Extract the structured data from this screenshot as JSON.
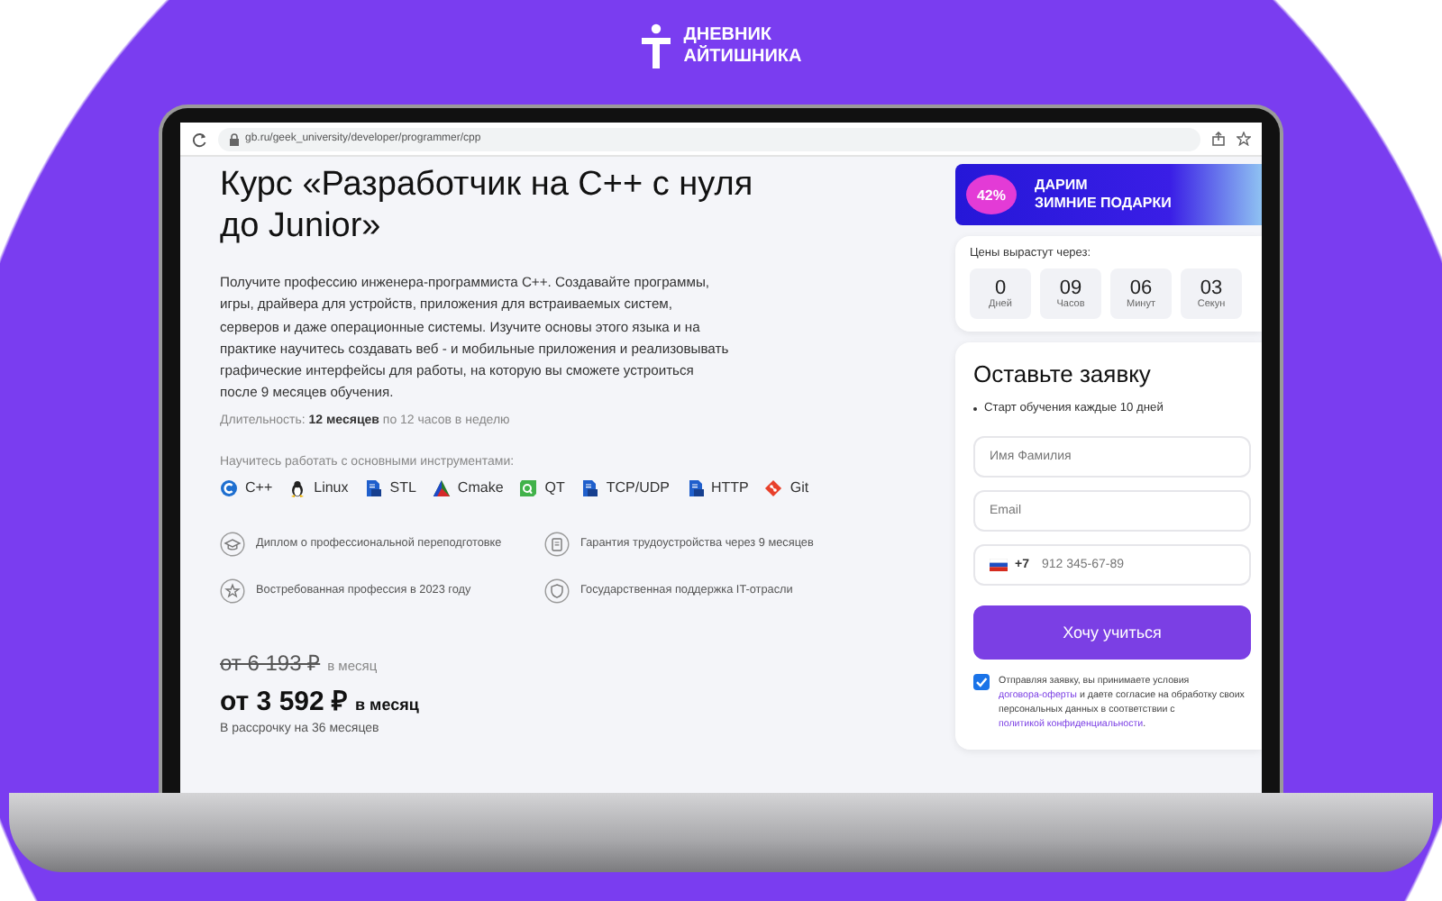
{
  "brand": {
    "line1": "ДНЕВНИК",
    "line2": "АЙТИШНИКА"
  },
  "browser": {
    "url": "gb.ru/geek_university/developer/programmer/cpp"
  },
  "course": {
    "title": "Курс «Разработчик на С++ с нуля до Junior»",
    "description": "Получите профессию инженера-программиста С++. Создавайте программы, игры, драйвера для устройств, приложения для встраиваемых систем, серверов и даже операционные системы. Изучите основы этого языка и на практике научитесь создавать веб - и мобильные приложения и реализовывать графические интерфейсы для работы, на которую вы сможете устроиться после 9 месяцев обучения.",
    "duration": "Длительность: **12 месяцев** по 12 часов в неделю",
    "tools_heading": "Научитесь работать с основными инструментами:",
    "tools": [
      {
        "kind": "cpp",
        "label": "C++"
      },
      {
        "kind": "linux",
        "label": "Linux"
      },
      {
        "kind": "doc",
        "label": "STL"
      },
      {
        "kind": "triangle",
        "label": "Cmake"
      },
      {
        "kind": "qt",
        "label": "QT"
      },
      {
        "kind": "doc",
        "label": "TCP/UDP"
      },
      {
        "kind": "doc",
        "label": "HTTP"
      },
      {
        "kind": "git",
        "label": "Git"
      }
    ],
    "features": [
      {
        "kind": "diploma",
        "text": "Диплом о профессиональной переподготовке"
      },
      {
        "kind": "document",
        "text": "Гарантия трудоустройства через 9 месяцев"
      },
      {
        "kind": "star",
        "text": "Востребованная профессия в 2023 году"
      },
      {
        "kind": "shield",
        "text": "Государственная поддержка IT-отрасли"
      }
    ],
    "old_price": "от 6 193 ₽",
    "old_price_suffix": "в месяц",
    "price": "от 3 592 ₽",
    "price_suffix": "в месяц",
    "installment": "В рассрочку на 36 месяцев"
  },
  "promo": {
    "badge": "42%",
    "line1": "ДАРИМ",
    "line2": "ЗИМНИЕ ПОДАРКИ"
  },
  "timer": {
    "heading": "Цены вырастут через:",
    "cells": [
      {
        "value": "0",
        "unit": "Дней"
      },
      {
        "value": "09",
        "unit": "Часов"
      },
      {
        "value": "06",
        "unit": "Минут"
      },
      {
        "value": "03",
        "unit": "Секун"
      }
    ]
  },
  "form": {
    "title": "Оставьте заявку",
    "bullet": "Старт обучения каждые 10 дней",
    "fields": [
      {
        "kind": "text",
        "placeholder": "Имя Фамилия"
      },
      {
        "kind": "text",
        "placeholder": "Email"
      },
      {
        "kind": "phone",
        "code": "+7",
        "placeholder": "912 345-67-89"
      }
    ],
    "button": "Хочу учиться",
    "consent": {
      "checked": true,
      "parts": [
        {
          "kind": "text",
          "text": "Отправляя заявку, вы принимаете условия "
        },
        {
          "kind": "link",
          "text": "договора-оферты"
        },
        {
          "kind": "text",
          "text": " и даете согласие на обработку своих персональных данных в соответствии с "
        },
        {
          "kind": "link",
          "text": "политикой конфиденциальности"
        },
        {
          "kind": "text",
          "text": "."
        }
      ]
    }
  }
}
